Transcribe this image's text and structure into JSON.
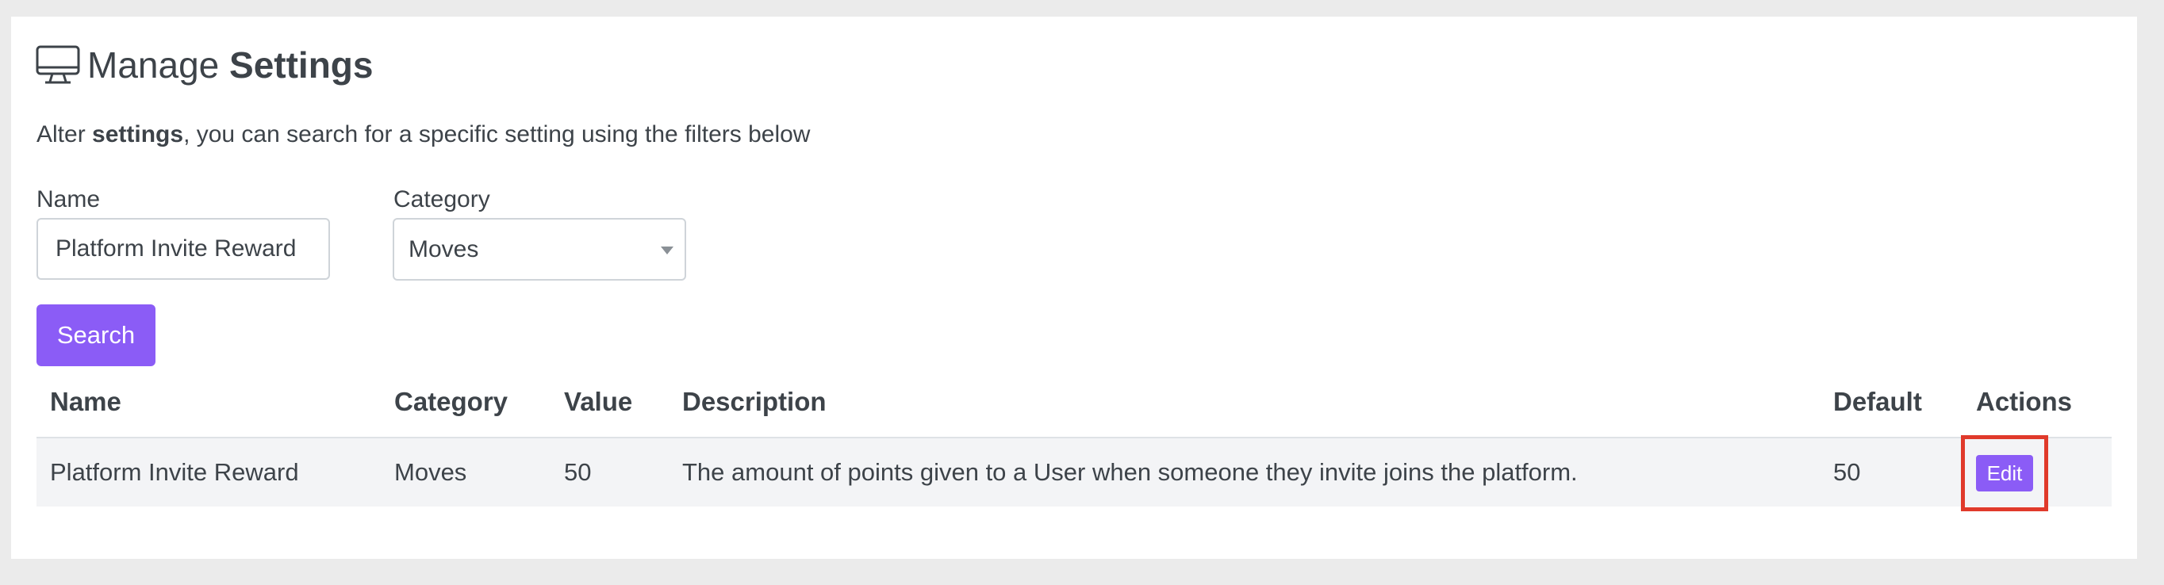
{
  "page": {
    "title_prefix": "Manage ",
    "title_strong": "Settings",
    "subtitle_prefix": "Alter ",
    "subtitle_strong": "settings",
    "subtitle_suffix": ", you can search for a specific setting using the filters below",
    "title_icon": "monitor-icon"
  },
  "filters": {
    "name_label": "Name",
    "name_value": "Platform Invite Reward",
    "category_label": "Category",
    "category_value": "Moves",
    "search_label": "Search"
  },
  "table": {
    "headers": [
      "Name",
      "Category",
      "Value",
      "Description",
      "Default",
      "Actions"
    ],
    "rows": [
      {
        "name": "Platform Invite Reward",
        "category": "Moves",
        "value": "50",
        "description": "The amount of points given to a User when someone they invite joins the platform.",
        "default": "50",
        "action_label": "Edit"
      }
    ]
  },
  "colors": {
    "accent": "#8b5cf6",
    "highlight": "#e03a2b",
    "text": "#3d4349",
    "page_bg": "#ebebeb",
    "row_bg": "#f3f4f6"
  }
}
